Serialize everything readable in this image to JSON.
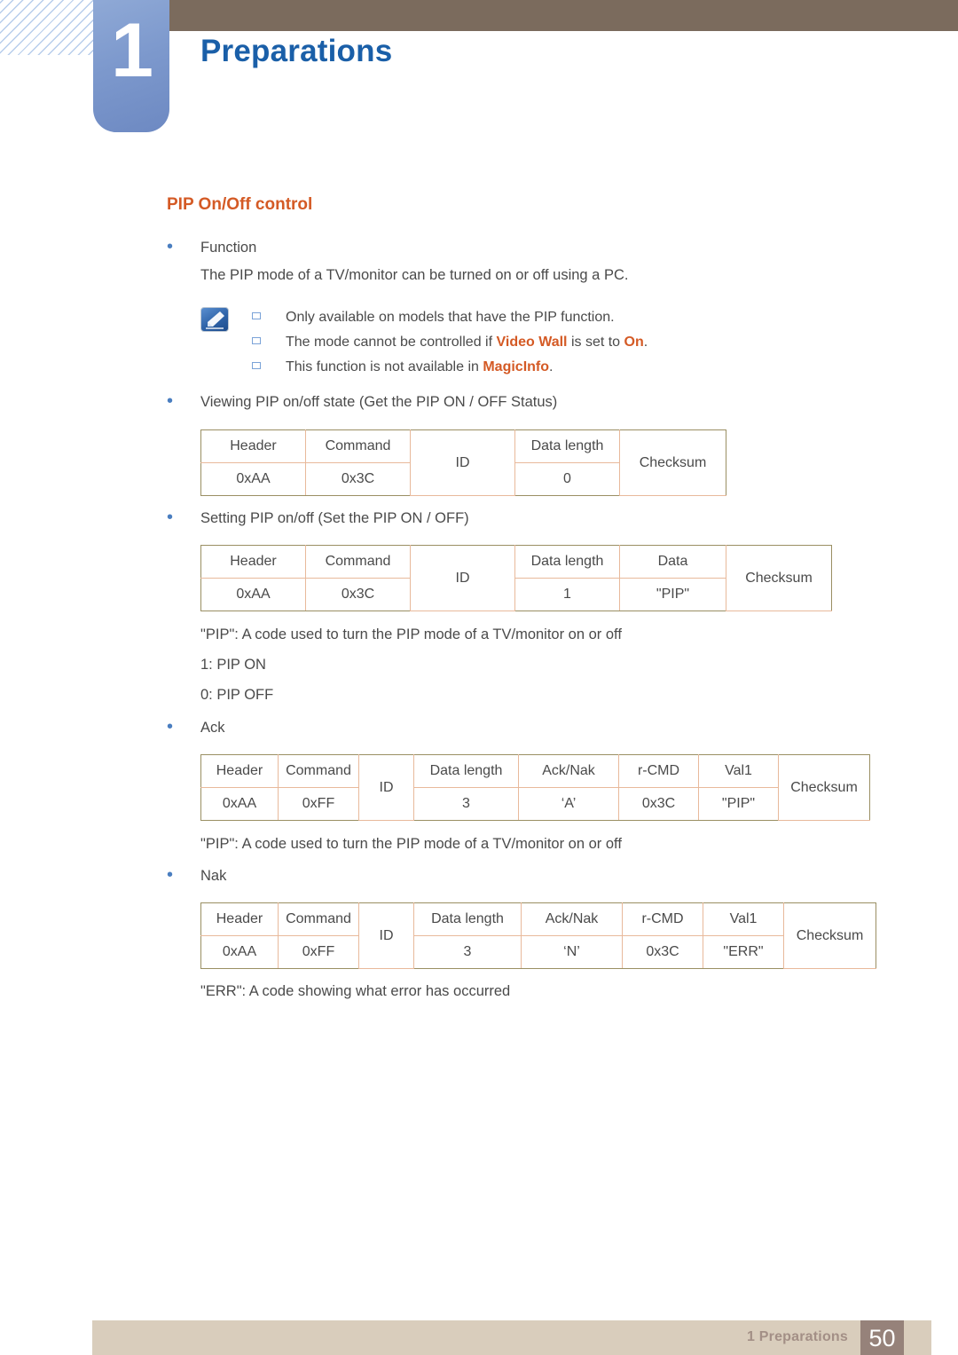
{
  "header": {
    "chapter_number": "1",
    "chapter_title": "Preparations",
    "bar_color": "#7b6b5d",
    "chapter_block_color": "#7d99cd",
    "title_color": "#1a5fa8"
  },
  "section": {
    "title": "PIP On/Off control",
    "title_color": "#d45a25"
  },
  "blocks": {
    "function_label": "Function",
    "function_desc": "The PIP mode of a TV/monitor can be turned on or off using a PC.",
    "viewing_label": "Viewing PIP on/off state (Get the PIP ON / OFF Status)",
    "setting_label": "Setting PIP on/off (Set the PIP ON / OFF)",
    "pip_code_desc": "\"PIP\": A code used to turn the PIP mode of a TV/monitor on or off",
    "pip_on": "1: PIP ON",
    "pip_off": "0: PIP OFF",
    "ack_label": "Ack",
    "ack_code_desc": "\"PIP\": A code used to turn the PIP mode of a TV/monitor on or off",
    "nak_label": "Nak",
    "err_code_desc": "\"ERR\": A code showing what error has occurred"
  },
  "note": {
    "icon": "note-pencil-icon",
    "items": [
      {
        "pre": "Only available on models that have the PIP function.",
        "hl1": "",
        "mid": "",
        "hl2": "",
        "post": ""
      },
      {
        "pre": "The mode cannot be controlled if ",
        "hl1": "Video Wall",
        "mid": " is set to ",
        "hl2": "On",
        "post": "."
      },
      {
        "pre": "This function is not available in ",
        "hl1": "MagicInfo",
        "mid": "",
        "hl2": "",
        "post": "."
      }
    ],
    "highlight_color": "#d45a25"
  },
  "tables": [
    {
      "name": "get-pip-status-table",
      "columns": [
        "Header",
        "Command",
        "ID",
        "Data length",
        "Checksum"
      ],
      "values": [
        "0xAA",
        "0x3C",
        "",
        "0",
        ""
      ],
      "merged": [
        "ID",
        "Checksum"
      ]
    },
    {
      "name": "set-pip-table",
      "columns": [
        "Header",
        "Command",
        "ID",
        "Data length",
        "Data",
        "Checksum"
      ],
      "values": [
        "0xAA",
        "0x3C",
        "",
        "1",
        "\"PIP\"",
        ""
      ],
      "merged": [
        "ID",
        "Checksum"
      ]
    },
    {
      "name": "ack-table",
      "columns": [
        "Header",
        "Command",
        "ID",
        "Data length",
        "Ack/Nak",
        "r-CMD",
        "Val1",
        "Checksum"
      ],
      "values": [
        "0xAA",
        "0xFF",
        "",
        "3",
        "‘A’",
        "0x3C",
        "\"PIP\"",
        ""
      ],
      "merged": [
        "ID",
        "Checksum"
      ]
    },
    {
      "name": "nak-table",
      "columns": [
        "Header",
        "Command",
        "ID",
        "Data length",
        "Ack/Nak",
        "r-CMD",
        "Val1",
        "Checksum"
      ],
      "values": [
        "0xAA",
        "0xFF",
        "",
        "3",
        "‘N’",
        "0x3C",
        "\"ERR\"",
        ""
      ],
      "merged": [
        "ID",
        "Checksum"
      ]
    }
  ],
  "footer": {
    "label": "1 Preparations",
    "page_number": "50",
    "bar_color": "#d9cdbc",
    "page_box_color": "#96827a",
    "label_color": "#a38f86"
  }
}
